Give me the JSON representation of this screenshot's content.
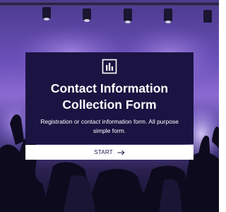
{
  "form": {
    "icon": "bar-chart-icon",
    "title": "Contact Information Collection Form",
    "description": "Registration or contact information form. All purpose simple form.",
    "start_label": "START",
    "start_icon": "arrow-right-icon"
  },
  "colors": {
    "card_background": "#1b1442",
    "button_background": "#ffffff",
    "button_text": "#1b1442",
    "title_text": "#ffffff"
  }
}
